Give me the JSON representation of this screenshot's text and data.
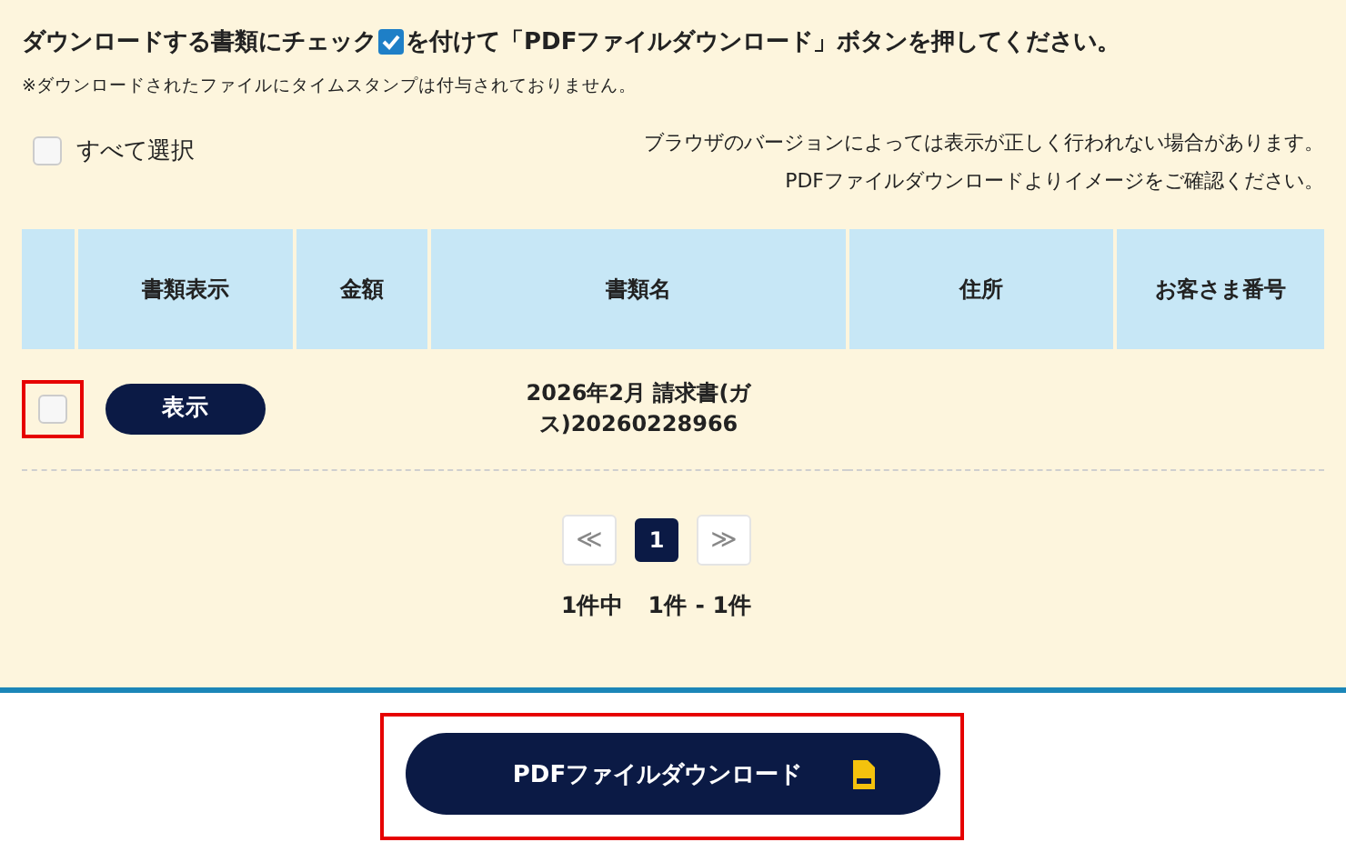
{
  "instruction": {
    "before": "ダウンロードする書類にチェック",
    "after": "を付けて「PDFファイルダウンロード」ボタンを押してください。"
  },
  "note": "※ダウンロードされたファイルにタイムスタンプは付与されておりません。",
  "select_all": {
    "label": "すべて選択",
    "checked": false
  },
  "browser_notice": [
    "ブラウザのバージョンによっては表示が正しく行われない場合があります。",
    "PDFファイルダウンロードよりイメージをご確認ください。"
  ],
  "table": {
    "columns": [
      "書類表示",
      "金額",
      "書類名",
      "住所",
      "お客さま番号"
    ],
    "rows": [
      {
        "checked": false,
        "highlighted": true,
        "view_button": "表示",
        "amount": "",
        "document_name": "2026年2月 請求書(ガス)20260228966",
        "address": "",
        "customer_number": ""
      }
    ]
  },
  "pagination": {
    "prev": "≪",
    "pages": [
      {
        "label": "1",
        "selected": true
      }
    ],
    "next": "≫"
  },
  "count": "1件中　1件 - 1件",
  "download_button": {
    "label": "PDFファイルダウンロード",
    "highlighted": true
  }
}
